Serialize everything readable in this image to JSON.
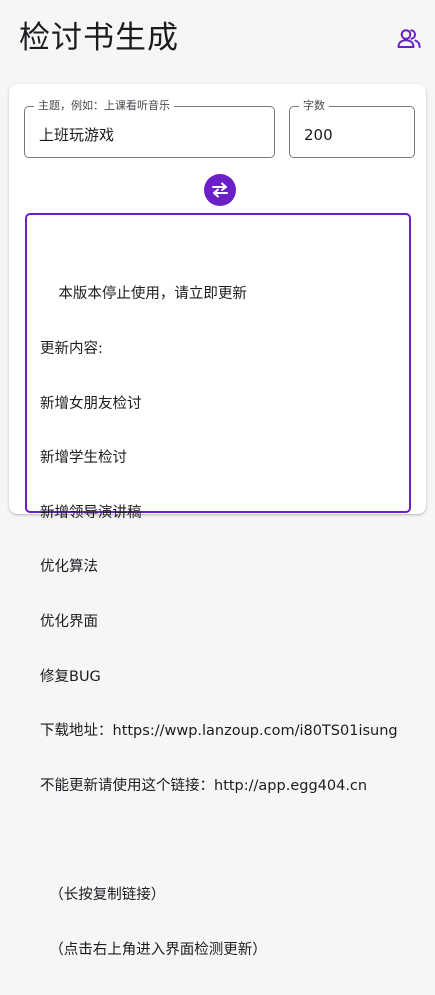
{
  "app_title": "检讨书生成",
  "icons": {
    "people": "people-group-icon",
    "swap": "swap-arrows-icon"
  },
  "colors": {
    "accent": "#6a1fc9",
    "background": "#f7f6f7"
  },
  "form": {
    "topic": {
      "label": "主题，例如：上课看听音乐",
      "value": "上班玩游戏"
    },
    "word_count": {
      "label": "字数",
      "value": "200"
    }
  },
  "result": {
    "lines": [
      "    本版本停止使用，请立即更新",
      "更新内容:",
      "新增女朋友检讨",
      "新增学生检讨",
      "新增领导演讲稿",
      "优化算法",
      "优化界面",
      "修复BUG",
      "下载地址：https://wwp.lanzoup.com/i80TS01isung",
      "不能更新请使用这个链接：http://app.egg404.cn",
      "",
      "  （长按复制链接）",
      "  （点击右上角进入界面检测更新）"
    ]
  }
}
